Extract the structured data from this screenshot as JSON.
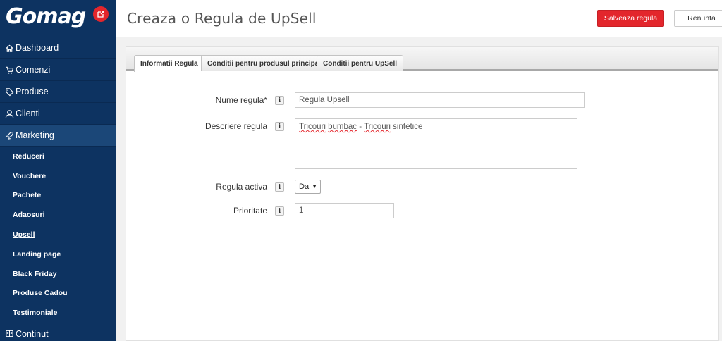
{
  "brand": {
    "logo_text": "Gomag",
    "accent": "#e3262c",
    "sidebar_bg": "#0d3361"
  },
  "sidebar": {
    "items": [
      {
        "label": "Dashboard",
        "icon": "home-icon"
      },
      {
        "label": "Comenzi",
        "icon": "cart-icon"
      },
      {
        "label": "Produse",
        "icon": "tag-icon"
      },
      {
        "label": "Clienti",
        "icon": "user-icon"
      },
      {
        "label": "Marketing",
        "icon": "rocket-icon",
        "active": true
      }
    ],
    "submenu": [
      {
        "label": "Reduceri"
      },
      {
        "label": "Vouchere"
      },
      {
        "label": "Pachete"
      },
      {
        "label": "Adaosuri"
      },
      {
        "label": "Upsell",
        "current": true
      },
      {
        "label": "Landing page"
      },
      {
        "label": "Black Friday"
      },
      {
        "label": "Produse Cadou"
      },
      {
        "label": "Testimoniale"
      }
    ],
    "last_item": {
      "label": "Continut",
      "icon": "book-icon"
    }
  },
  "header": {
    "title": "Creaza o Regula de UpSell",
    "save_label": "Salveaza regula",
    "cancel_label": "Renunta"
  },
  "tabs": [
    {
      "label": "Informatii Regula",
      "active": true
    },
    {
      "label": "Conditii pentru produsul principal",
      "active": false
    },
    {
      "label": "Conditii pentru UpSell",
      "active": false
    }
  ],
  "form": {
    "info_glyph": "i",
    "name_label": "Nume regula*",
    "name_value": "Regula Upsell",
    "desc_label": "Descriere regula",
    "desc_words": [
      "Tricouri",
      " ",
      "bumbac",
      " - ",
      "Tricouri",
      " sintetice"
    ],
    "active_label": "Regula activa",
    "active_value": "Da",
    "active_arrow": "▼",
    "priority_label": "Prioritate",
    "priority_value": "1"
  }
}
